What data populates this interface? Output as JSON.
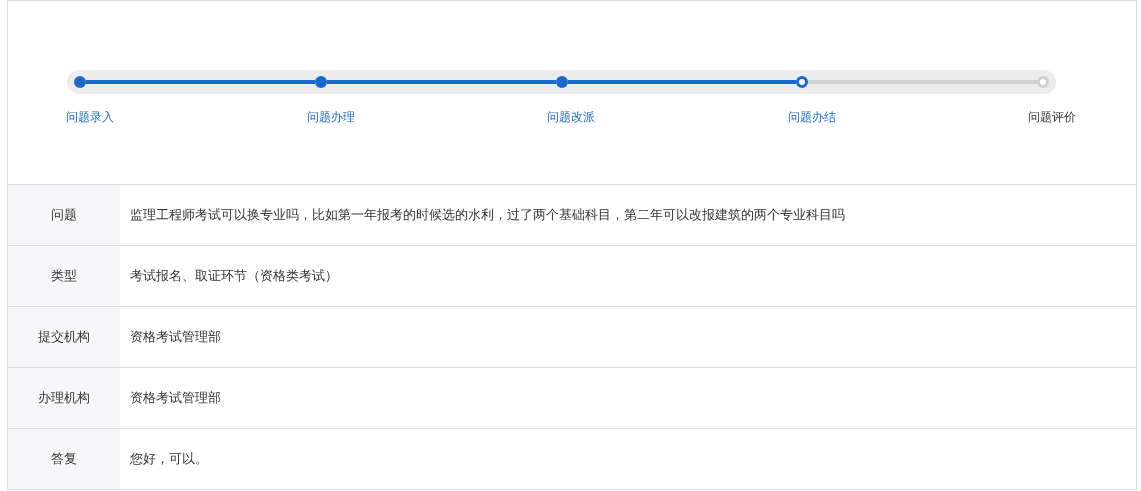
{
  "steps": [
    {
      "label": "问题录入",
      "kind": "done"
    },
    {
      "label": "问题办理",
      "kind": "done"
    },
    {
      "label": "问题改派",
      "kind": "done"
    },
    {
      "label": "问题办结",
      "kind": "current"
    },
    {
      "label": "问题评价",
      "kind": "pending"
    }
  ],
  "details": [
    {
      "label": "问题",
      "value": "监理工程师考试可以换专业吗，比如第一年报考的时候选的水利，过了两个基础科目，第二年可以改报建筑的两个专业科目吗"
    },
    {
      "label": "类型",
      "value": "考试报名、取证环节（资格类考试）"
    },
    {
      "label": "提交机构",
      "value": "资格考试管理部"
    },
    {
      "label": "办理机构",
      "value": "资格考试管理部"
    },
    {
      "label": "答复",
      "value": "您好，可以。"
    }
  ]
}
